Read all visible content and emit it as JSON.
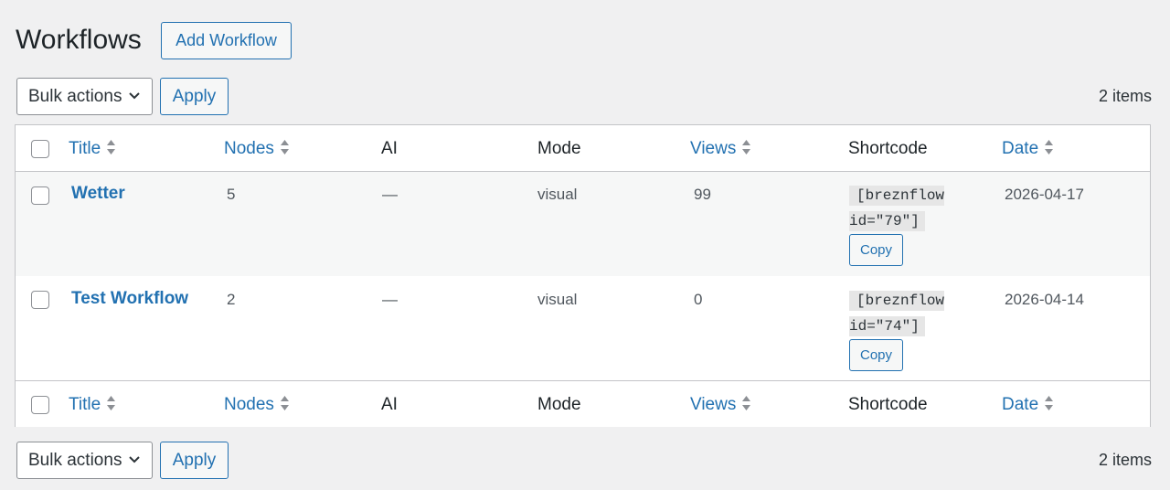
{
  "header": {
    "title": "Workflows",
    "add_button": "Add Workflow"
  },
  "tablenav_top": {
    "bulk_actions": "Bulk actions",
    "apply": "Apply",
    "count": "2 items"
  },
  "tablenav_bottom": {
    "bulk_actions": "Bulk actions",
    "apply": "Apply",
    "count": "2 items"
  },
  "columns": {
    "title": "Title",
    "nodes": "Nodes",
    "ai": "AI",
    "mode": "Mode",
    "views": "Views",
    "shortcode": "Shortcode",
    "date": "Date"
  },
  "rows": [
    {
      "title": "Wetter",
      "nodes": "5",
      "ai": "—",
      "mode": "visual",
      "views": "99",
      "shortcode_line1": "[breznflow",
      "shortcode_line2": "id=\"79\"]",
      "copy": "Copy",
      "date": "2026-04-17"
    },
    {
      "title": "Test Workflow",
      "nodes": "2",
      "ai": "—",
      "mode": "visual",
      "views": "0",
      "shortcode_line1": "[breznflow",
      "shortcode_line2": "id=\"74\"]",
      "copy": "Copy",
      "date": "2026-04-14"
    }
  ],
  "colors": {
    "accent": "#2271b1",
    "background": "#f0f0f1",
    "border": "#c3c4c7"
  },
  "icons": {
    "sort": "sort-arrows-icon",
    "dropdown": "chevron-down-icon"
  }
}
